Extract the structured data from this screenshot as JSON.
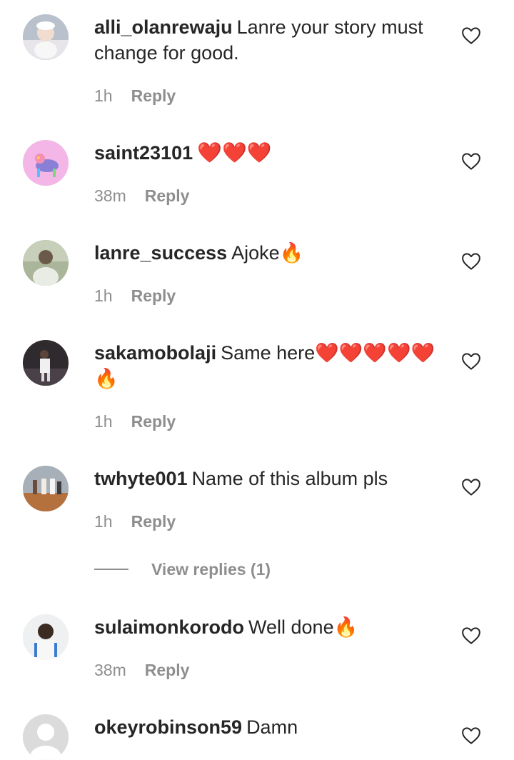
{
  "comments": [
    {
      "username": "alli_olanrewaju",
      "text": "Lanre your story must change for good.",
      "time": "1h",
      "reply": "Reply"
    },
    {
      "username": "saint23101",
      "text": "❤️❤️❤️",
      "time": "38m",
      "reply": "Reply"
    },
    {
      "username": "lanre_success",
      "text": "Ajoke🔥",
      "time": "1h",
      "reply": "Reply"
    },
    {
      "username": "sakamobolaji",
      "text": "Same here❤️❤️❤️❤️❤️🔥",
      "time": "1h",
      "reply": "Reply"
    },
    {
      "username": "twhyte001",
      "text": "Name of this album pls",
      "time": "1h",
      "reply": "Reply"
    },
    {
      "username": "sulaimonkorodo",
      "text": "Well done🔥",
      "time": "38m",
      "reply": "Reply"
    },
    {
      "username": "okeyrobinson59",
      "text": "Damn",
      "time": "",
      "reply": ""
    }
  ],
  "view_replies": "View replies (1)",
  "icons": {
    "like": "heart-outline-icon"
  }
}
